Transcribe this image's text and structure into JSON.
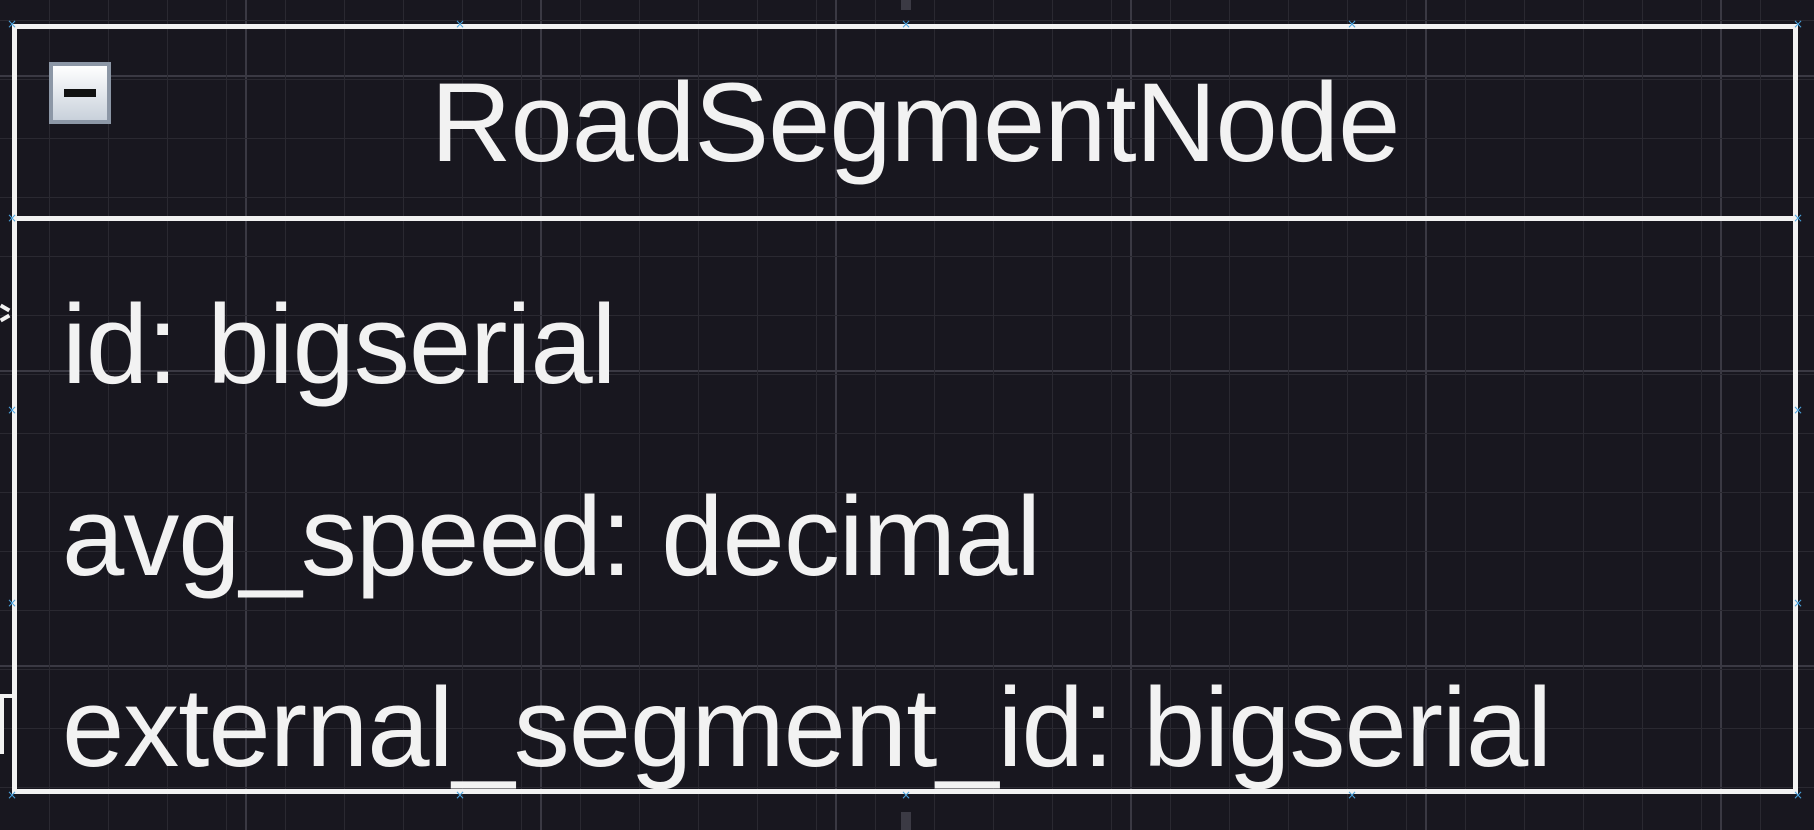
{
  "class": {
    "name": "RoadSegmentNode",
    "attributes": [
      "id: bigserial",
      "avg_speed: decimal",
      "external_segment_id: bigserial"
    ]
  },
  "icons": {
    "collapse": "minus-icon",
    "handle": "×"
  },
  "colors": {
    "background": "#18171f",
    "stroke": "#f2f2f2",
    "handle": "#4aa3df",
    "toggle_border": "#8c97a6"
  }
}
